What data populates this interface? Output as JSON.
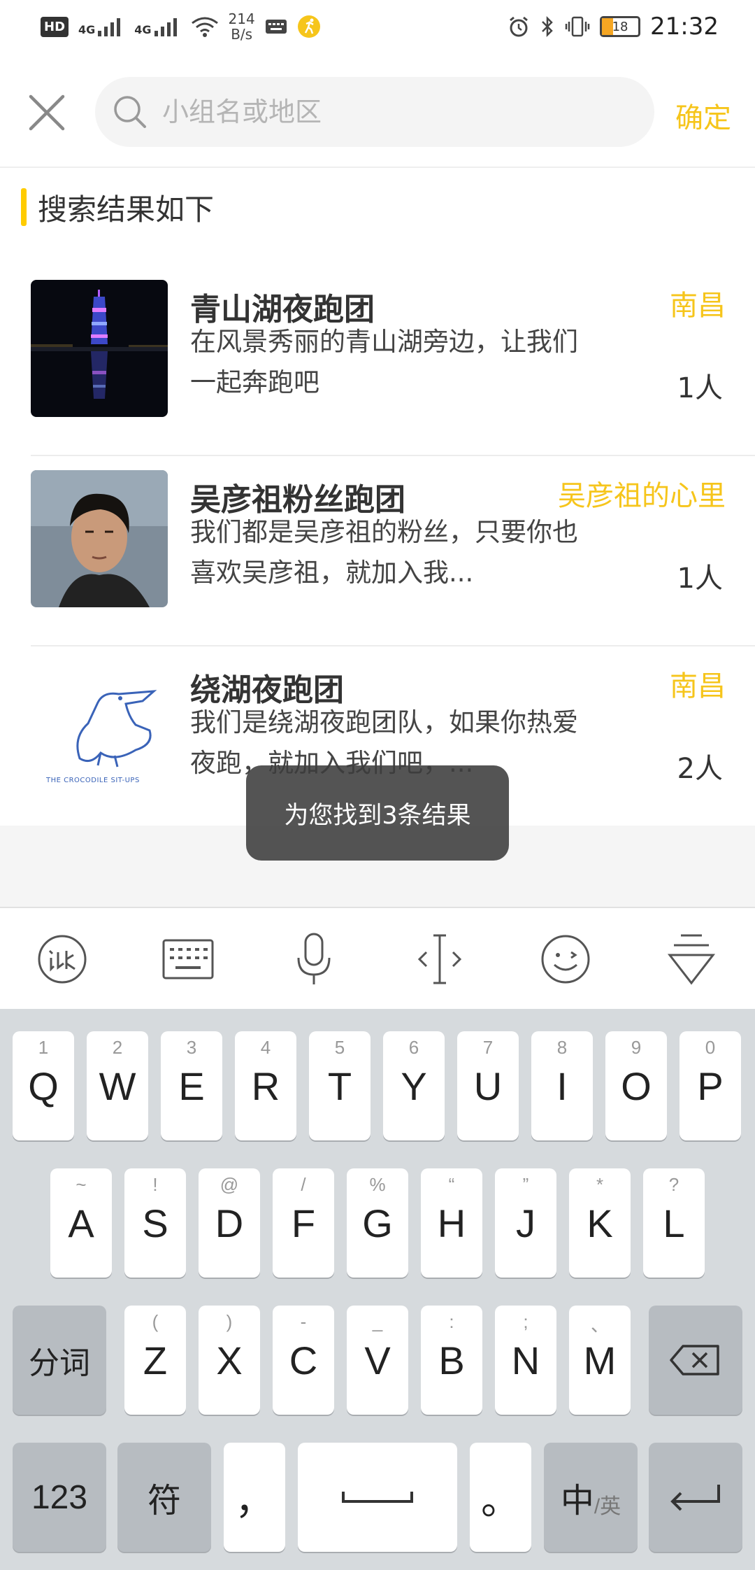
{
  "status_bar": {
    "hd": "HD",
    "net1": "4G",
    "net2": "4G",
    "speed_value": "214",
    "speed_unit": "B/s",
    "battery": "18",
    "time": "21:32"
  },
  "search": {
    "placeholder": "小组名或地区",
    "value": "",
    "confirm_label": "确定"
  },
  "section_title": "搜索结果如下",
  "results": [
    {
      "name": "青山湖夜跑团",
      "region": "南昌",
      "description": "在风景秀丽的青山湖旁边，让我们一起奔跑吧",
      "count": "1人"
    },
    {
      "name": "吴彦祖粉丝跑团",
      "region": "吴彦祖的心里",
      "description": "我们都是吴彦祖的粉丝，只要你也喜欢吴彦祖，就加入我...",
      "count": "1人"
    },
    {
      "name": "绕湖夜跑团",
      "region": "南昌",
      "description": "我们是绕湖夜跑团队，如果你热爱夜跑，就加入我们吧，...",
      "count": "2人",
      "thumb_caption": "THE CROCODILE SIT-UPS"
    }
  ],
  "toast": "为您找到3条结果",
  "keyboard": {
    "toolbar": [
      "xunfei-icon",
      "keyboard-icon",
      "microphone-icon",
      "cursor-icon",
      "emoji-icon",
      "collapse-keyboard-icon"
    ],
    "row1": [
      {
        "main": "Q",
        "sub": "1"
      },
      {
        "main": "W",
        "sub": "2"
      },
      {
        "main": "E",
        "sub": "3"
      },
      {
        "main": "R",
        "sub": "4"
      },
      {
        "main": "T",
        "sub": "5"
      },
      {
        "main": "Y",
        "sub": "6"
      },
      {
        "main": "U",
        "sub": "7"
      },
      {
        "main": "I",
        "sub": "8"
      },
      {
        "main": "O",
        "sub": "9"
      },
      {
        "main": "P",
        "sub": "0"
      }
    ],
    "row2": [
      {
        "main": "A",
        "sub": "~"
      },
      {
        "main": "S",
        "sub": "!"
      },
      {
        "main": "D",
        "sub": "@"
      },
      {
        "main": "F",
        "sub": "/"
      },
      {
        "main": "G",
        "sub": "%"
      },
      {
        "main": "H",
        "sub": "“"
      },
      {
        "main": "J",
        "sub": "”"
      },
      {
        "main": "K",
        "sub": "*"
      },
      {
        "main": "L",
        "sub": "?"
      }
    ],
    "row3": [
      {
        "main": "Z",
        "sub": "("
      },
      {
        "main": "X",
        "sub": ")"
      },
      {
        "main": "C",
        "sub": "-"
      },
      {
        "main": "V",
        "sub": "_"
      },
      {
        "main": "B",
        "sub": ":"
      },
      {
        "main": "N",
        "sub": ";"
      },
      {
        "main": "M",
        "sub": "、"
      }
    ],
    "segment_label": "分词",
    "num_label": "123",
    "symbol_label": "符",
    "comma_label": "，",
    "period_label": "。",
    "lang_main": "中",
    "lang_sub": "/英"
  }
}
